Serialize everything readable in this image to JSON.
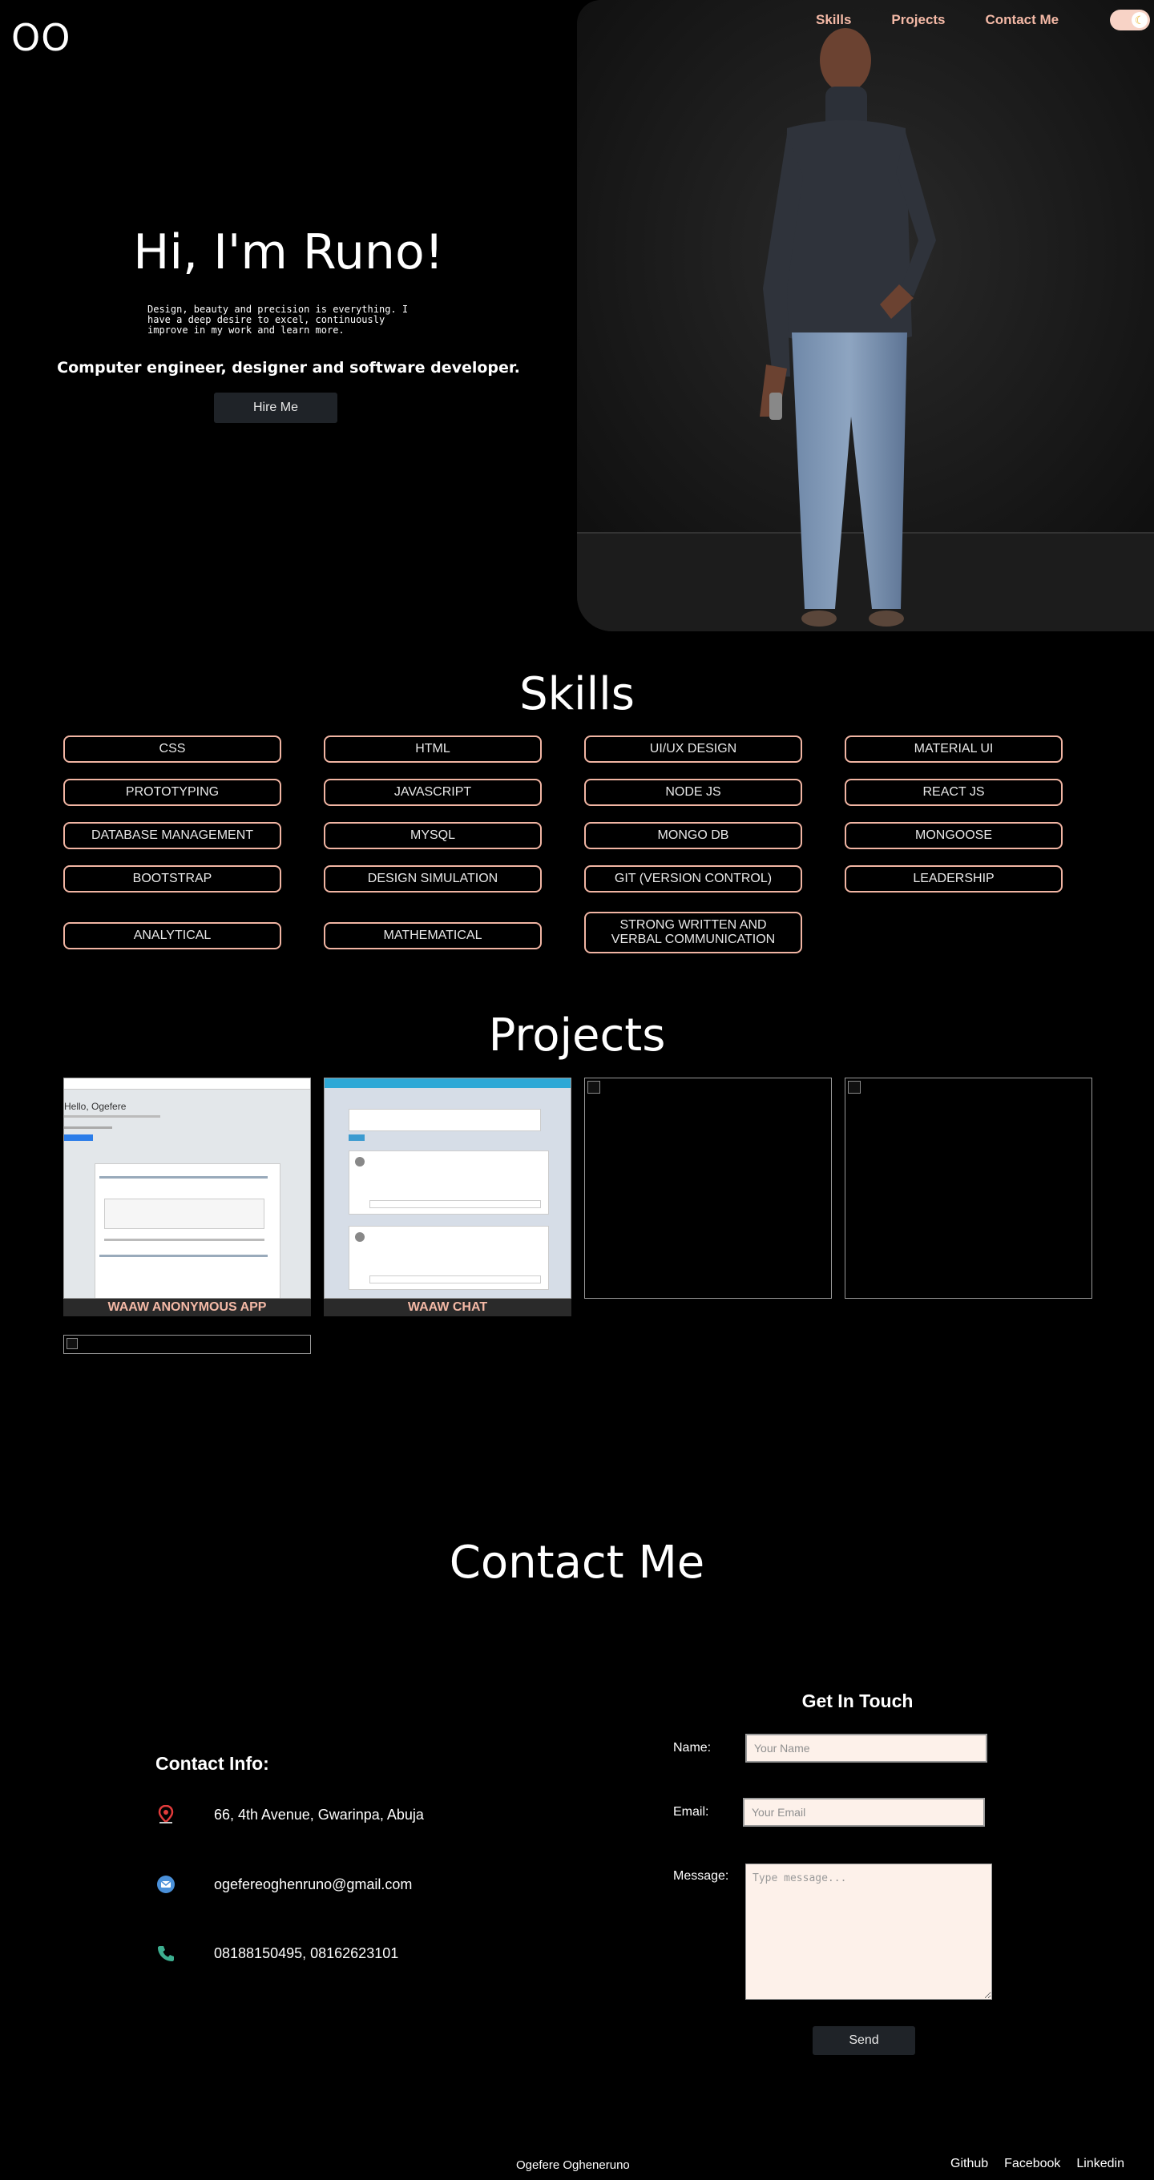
{
  "header": {
    "logo": "OO",
    "nav": [
      {
        "label": "Skills"
      },
      {
        "label": "Projects"
      },
      {
        "label": "Contact Me"
      }
    ]
  },
  "hero": {
    "title": "Hi, I'm Runo!",
    "description": "Design, beauty and precision is everything. I have a deep desire to excel, continuously improve in my work and learn more.",
    "role": "Computer engineer, designer and software developer.",
    "hire_label": "Hire Me"
  },
  "skills": {
    "title": "Skills",
    "items": [
      "CSS",
      "HTML",
      "UI/UX DESIGN",
      "MATERIAL UI",
      "PROTOTYPING",
      "JAVASCRIPT",
      "NODE JS",
      "REACT JS",
      "DATABASE MANAGEMENT",
      "MYSQL",
      "MONGO DB",
      "MONGOOSE",
      "BOOTSTRAP",
      "DESIGN SIMULATION",
      "GIT (VERSION CONTROL)",
      "LEADERSHIP",
      "ANALYTICAL",
      "MATHEMATICAL",
      "STRONG WRITTEN AND VERBAL COMMUNICATION"
    ]
  },
  "projects": {
    "title": "Projects",
    "items": [
      {
        "caption": "WAAW ANONYMOUS APP",
        "preview_greeting": "Hello, Ogefere"
      },
      {
        "caption": "WAAW CHAT"
      }
    ]
  },
  "contact": {
    "title": "Contact Me",
    "info_title": "Contact Info:",
    "address": "66, 4th Avenue, Gwarinpa, Abuja",
    "email": "ogefereoghenruno@gmail.com",
    "phone": "08188150495, 08162623101",
    "form": {
      "title": "Get In Touch",
      "name_label": "Name:",
      "name_placeholder": "Your Name",
      "email_label": "Email:",
      "email_placeholder": "Your Email",
      "message_label": "Message:",
      "message_placeholder": "Type message...",
      "send_label": "Send"
    }
  },
  "footer": {
    "name": "Ogefere Ogheneruno",
    "links": [
      "Github",
      "Facebook",
      "Linkedin"
    ]
  }
}
